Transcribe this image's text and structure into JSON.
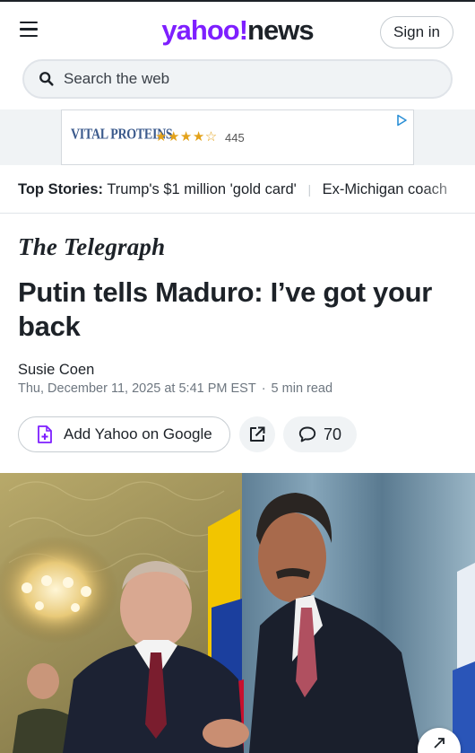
{
  "header": {
    "logo_yahoo": "yahoo",
    "logo_bang": "!",
    "logo_news": "news",
    "signin_label": "Sign in",
    "menu_icon": "hamburger-icon"
  },
  "search": {
    "placeholder": "Search the web",
    "icon": "search-icon"
  },
  "ad": {
    "brand": "VITAL PROTEINS",
    "stars": "★★★★☆",
    "rating_count": "445",
    "icon": "ad-choices-icon"
  },
  "top_stories": {
    "label": "Top Stories:",
    "items": [
      "Trump's $1 million 'gold card'",
      "Ex-Michigan coach"
    ]
  },
  "article": {
    "publisher": "The Telegraph",
    "headline": "Putin tells Maduro: I’ve got your back",
    "author": "Susie Coen",
    "date": "Thu, December 11, 2025 at 5:41 PM EST",
    "read_time": "5 min read"
  },
  "actions": {
    "google_label": "Add Yahoo on Google",
    "comments_count": "70",
    "share_icon": "share-icon",
    "comment_icon": "comment-icon"
  },
  "colors": {
    "brand_purple": "#7e1fff",
    "text_dark": "#1d2228",
    "pill_bg": "#f0f3f5"
  }
}
